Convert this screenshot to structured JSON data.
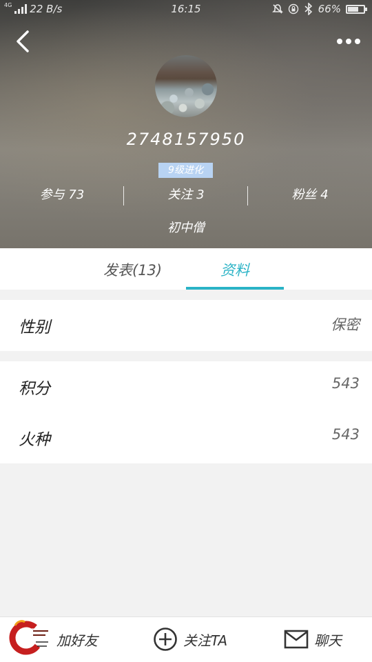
{
  "status_bar": {
    "network": "4G",
    "speed": "22 B/s",
    "time": "16:15",
    "battery": "66%",
    "battery_level": 0.66
  },
  "profile": {
    "user_id": "2748157950",
    "level": "9级进化",
    "stats": [
      {
        "label": "参与",
        "value": "73",
        "text": "参与 73"
      },
      {
        "label": "关注",
        "value": "3",
        "text": "关注 3"
      },
      {
        "label": "粉丝",
        "value": "4",
        "text": "粉丝 4"
      }
    ],
    "rank": "初中僧"
  },
  "tabs": [
    {
      "label": "发表(13)",
      "active": false
    },
    {
      "label": "资料",
      "active": true
    }
  ],
  "info": {
    "gender": {
      "label": "性别",
      "value": "保密"
    },
    "points": {
      "label": "积分",
      "value": "543"
    },
    "fire": {
      "label": "火种",
      "value": "543"
    }
  },
  "bottom_bar": {
    "add_friend": "加好友",
    "follow": "关注TA",
    "chat": "聊天"
  },
  "colors": {
    "accent": "#2ab3c6",
    "level_badge": "#b8d3f3",
    "background": "#f2f2f2"
  },
  "icons": [
    "back-arrow-icon",
    "more-dots-icon",
    "plus-circle-icon",
    "mail-icon",
    "alarm-off-icon",
    "lock-rotate-icon",
    "bluetooth-icon",
    "signal-icon",
    "battery-icon"
  ]
}
